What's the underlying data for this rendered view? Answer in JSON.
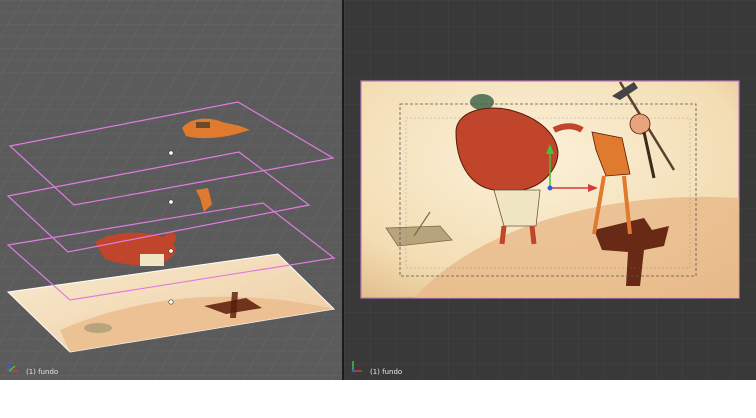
{
  "app": "3D editor split view",
  "left_viewport": {
    "label": "(1) fundo",
    "bg": "#5b5b5b",
    "grid_color": "#6a6a6a",
    "plane_outline_color": "#e07be0"
  },
  "right_viewport": {
    "label": "(1) fundo",
    "bg": "#393939",
    "grid_color": "#424242",
    "camera_frame_color": "#c079c0"
  },
  "icons": {
    "left_axis": "axis-gizmo-icon",
    "right_axis": "axis-gizmo-icon",
    "move_gizmo": "transform-gizmo-icon",
    "object_origin": "origin-dot-icon"
  },
  "colors": {
    "x_axis": "#d43a3a",
    "y_axis": "#3ec43e",
    "z_axis": "#3a5be0",
    "paper": "#f6e7c2",
    "sand": "#e9b98a",
    "hole": "#5a1a08",
    "figure_red": "#c0452a",
    "figure_orange": "#e07a2e"
  }
}
